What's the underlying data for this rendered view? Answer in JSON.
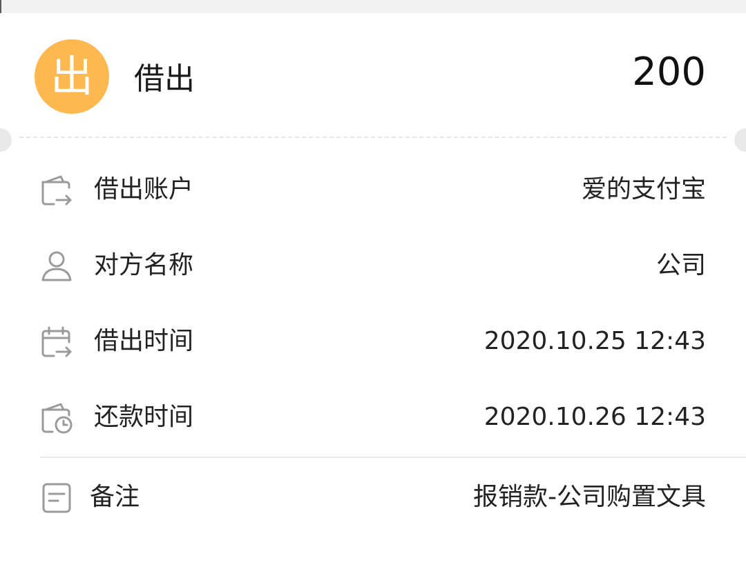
{
  "header": {
    "type_glyph": "出",
    "type_label": "借出",
    "amount": "200"
  },
  "rows": [
    {
      "icon": "wallet-transfer-icon",
      "label": "借出账户",
      "value": "爱的支付宝"
    },
    {
      "icon": "person-icon",
      "label": "对方名称",
      "value": "公司"
    },
    {
      "icon": "calendar-transfer-icon",
      "label": "借出时间",
      "value": "2020.10.25 12:43"
    },
    {
      "icon": "wallet-clock-icon",
      "label": "还款时间",
      "value": "2020.10.26 12:43"
    },
    {
      "icon": "note-icon",
      "label": "备注",
      "value": "报销款-公司购置文具"
    }
  ],
  "colors": {
    "accent": "#fdb84f",
    "icon_stroke": "#9a9a9a",
    "background": "#f2f2f2"
  }
}
